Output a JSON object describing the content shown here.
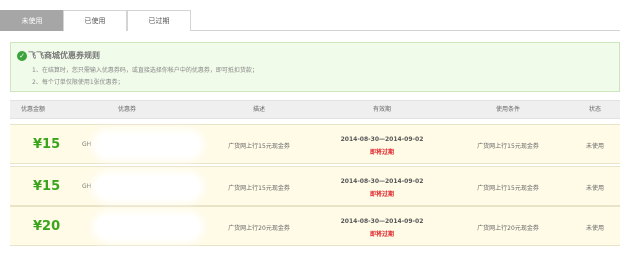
{
  "tabs": [
    "未使用",
    "已使用",
    "已过期"
  ],
  "rules": {
    "title": "飞飞商城优惠券规则",
    "lines": [
      "1、在结算时，您只需输入优惠券码，或直接选择你帐户中的优惠券，即可抵扣货款；",
      "2、每个订单仅限使用1张优惠券；"
    ]
  },
  "table": {
    "headers": [
      "优惠金额",
      "优惠券",
      "描述",
      "有效期",
      "使用条件",
      "状态"
    ],
    "rows": [
      {
        "amount": "¥15",
        "code": "GH",
        "desc": "广货网上行15元现金券",
        "date": "2014-08-30—2014-09-02",
        "expire": "即将过期",
        "cond": "广货网上行15元现金券",
        "status": "未使用"
      },
      {
        "amount": "¥15",
        "code": "GH",
        "desc": "广货网上行15元现金券",
        "date": "2014-08-30—2014-09-02",
        "expire": "即将过期",
        "cond": "广货网上行15元现金券",
        "status": "未使用"
      },
      {
        "amount": "¥20",
        "code": "",
        "desc": "广货网上行20元现金券",
        "date": "2014-08-30—2014-09-02",
        "expire": "即将过期",
        "cond": "广货网上行20元现金券",
        "status": "未使用"
      }
    ]
  },
  "colors": {
    "amount": "#3aa41d",
    "expire": "#e0262c",
    "rules_bg": "#f1fbea",
    "row_bg": "#fffbe7",
    "active_tab": "#a6a6a6"
  },
  "icons": {
    "rules": "check-circle-icon"
  }
}
